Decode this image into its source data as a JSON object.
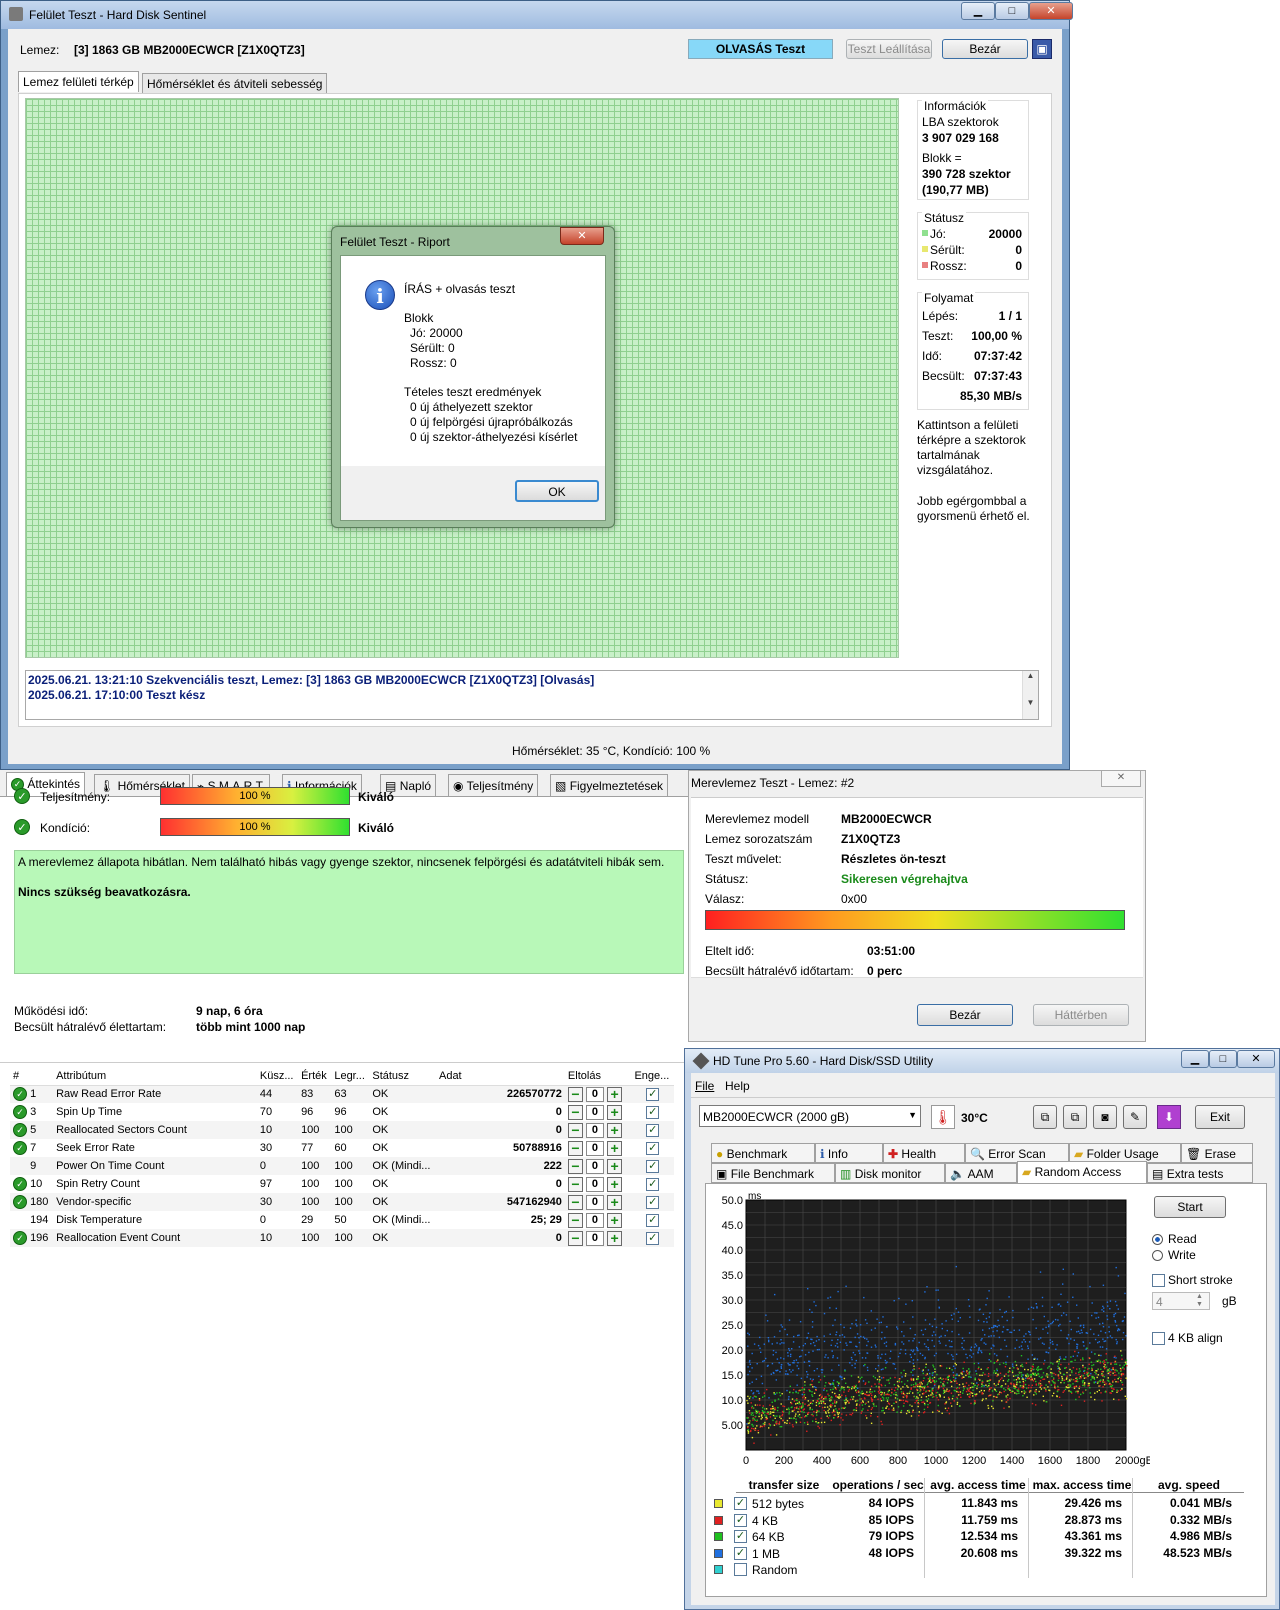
{
  "w1": {
    "title": "Felület Teszt - Hard Disk Sentinel",
    "disk_label": "Lemez:",
    "disk_value": "[3] 1863 GB  MB2000ECWCR [Z1X0QTZ3]",
    "mode_badge": "OLVASÁS Teszt",
    "stop_button": "Teszt Leállítása",
    "close_button": "Bezár",
    "tabs": [
      "Lemez felületi térkép",
      "Hőmérséklet és átviteli sebesség"
    ],
    "info": {
      "group": "Információk",
      "lba_label": "LBA szektorok",
      "lba_value": "3 907 029 168",
      "block_label": "Blokk =",
      "block_sectors": "390 728 szektor",
      "block_size": "(190,77 MB)"
    },
    "status": {
      "group": "Státusz",
      "good_label": "Jó:",
      "good_value": "20000",
      "damaged_label": "Sérült:",
      "damaged_value": "0",
      "bad_label": "Rossz:",
      "bad_value": "0"
    },
    "progress": {
      "group": "Folyamat",
      "step_label": "Lépés:",
      "step_value": "1 / 1",
      "test_label": "Teszt:",
      "test_value": "100,00 %",
      "time_label": "Idő:",
      "time_value": "07:37:42",
      "est_label": "Becsült:",
      "est_value": "07:37:43",
      "speed": "85,30 MB/s"
    },
    "hint1": "Kattintson a felületi térképre a szektorok tartalmának vizsgálatához.",
    "hint2": "Jobb egérgombbal a gyorsmenü érhető el.",
    "log": [
      "2025.06.21.  13:21:10   Szekvenciális teszt, Lemez: [3] 1863 GB  MB2000ECWCR [Z1X0QTZ3] [Olvasás]",
      "2025.06.21.  17:10:00   Teszt kész"
    ],
    "statusbar": "Hőmérséklet: 35  °C,  Kondíció: 100 %"
  },
  "dialog": {
    "title": "Felület Teszt - Riport",
    "heading": "ÍRÁS + olvasás teszt",
    "block": "Blokk",
    "good": "Jó: 20000",
    "damaged": "Sérült: 0",
    "bad": "Rossz: 0",
    "results_title": "Tételes teszt eredmények",
    "r1": "0 új áthelyezett szektor",
    "r2": "0 új felpörgési újrapróbálkozás",
    "r3": "0 új szektor-áthelyezési kísérlet",
    "ok": "OK"
  },
  "w2": {
    "tabs": [
      "Áttekintés",
      "Hőmérséklet",
      "S.M.A.R.T.",
      "Információk",
      "Napló",
      "Teljesítmény",
      "Figyelmeztetések"
    ],
    "perf_label": "Teljesítmény:",
    "perf_bar": "100 %",
    "perf_rating": "Kiváló",
    "perf_percent": 100,
    "cond_label": "Kondíció:",
    "cond_bar": "100 %",
    "cond_rating": "Kiváló",
    "cond_percent": 100,
    "message": "A merevlemez állapota hibátlan. Nem található hibás vagy gyenge szektor, nincsenek felpörgési és adatátviteli hibák sem.",
    "message_bold": "Nincs szükség beavatkozásra.",
    "uptime_label": "Működési idő:",
    "uptime_value": "9 nap, 6 óra",
    "life_label": "Becsült hátralévő élettartam:",
    "life_value": "több mint 1000 nap",
    "smart_headers": [
      "#",
      "Attribútum",
      "Küsz...",
      "Érték",
      "Legr...",
      "Státusz",
      "Adat",
      "Eltolás",
      "Enge..."
    ],
    "smart_rows": [
      {
        "ok": true,
        "id": "1",
        "name": "Raw Read Error Rate",
        "thr": "44",
        "val": "83",
        "worst": "63",
        "status": "OK",
        "data": "226570772",
        "offset": "0"
      },
      {
        "ok": true,
        "id": "3",
        "name": "Spin Up Time",
        "thr": "70",
        "val": "96",
        "worst": "96",
        "status": "OK",
        "data": "0",
        "offset": "0"
      },
      {
        "ok": true,
        "id": "5",
        "name": "Reallocated Sectors Count",
        "thr": "10",
        "val": "100",
        "worst": "100",
        "status": "OK",
        "data": "0",
        "offset": "0"
      },
      {
        "ok": true,
        "id": "7",
        "name": "Seek Error Rate",
        "thr": "30",
        "val": "77",
        "worst": "60",
        "status": "OK",
        "data": "50788916",
        "offset": "0"
      },
      {
        "ok": false,
        "id": "9",
        "name": "Power On Time Count",
        "thr": "0",
        "val": "100",
        "worst": "100",
        "status": "OK (Mindi...",
        "data": "222",
        "offset": "0"
      },
      {
        "ok": true,
        "id": "10",
        "name": "Spin Retry Count",
        "thr": "97",
        "val": "100",
        "worst": "100",
        "status": "OK",
        "data": "0",
        "offset": "0"
      },
      {
        "ok": true,
        "id": "180",
        "name": "Vendor-specific",
        "thr": "30",
        "val": "100",
        "worst": "100",
        "status": "OK",
        "data": "547162940",
        "offset": "0"
      },
      {
        "ok": false,
        "id": "194",
        "name": "Disk Temperature",
        "thr": "0",
        "val": "29",
        "worst": "50",
        "status": "OK (Mindi...",
        "data": "25; 29",
        "offset": "0"
      },
      {
        "ok": true,
        "id": "196",
        "name": "Reallocation Event Count",
        "thr": "10",
        "val": "100",
        "worst": "100",
        "status": "OK",
        "data": "0",
        "offset": "0"
      }
    ]
  },
  "w3": {
    "title": "Merevlemez Teszt - Lemez: #2",
    "model_label": "Merevlemez modell",
    "model_value": "MB2000ECWCR",
    "serial_label": "Lemez sorozatszám",
    "serial_value": "Z1X0QTZ3",
    "op_label": "Teszt művelet:",
    "op_value": "Részletes ön-teszt",
    "status_label": "Státusz:",
    "status_value": "Sikeresen végrehajtva",
    "resp_label": "Válasz:",
    "resp_value": "0x00",
    "elapsed_label": "Eltelt idő:",
    "elapsed_value": "03:51:00",
    "remain_label": "Becsült hátralévő időtartam:",
    "remain_value": "0 perc",
    "close_button": "Bezár",
    "bg_button": "Háttérben",
    "status_color": "#1a8a1a"
  },
  "w4": {
    "title": "HD Tune Pro 5.60 - Hard Disk/SSD Utility",
    "menu": [
      "File",
      "Help"
    ],
    "drive": "MB2000ECWCR (2000 gB)",
    "temp": "30°C",
    "exit": "Exit",
    "tabs_row1": [
      "Benchmark",
      "Info",
      "Health",
      "Error Scan",
      "Folder Usage",
      "Erase"
    ],
    "tabs_row2": [
      "File Benchmark",
      "Disk monitor",
      "AAM",
      "Random Access",
      "Extra tests"
    ],
    "start": "Start",
    "read": "Read",
    "write": "Write",
    "short_stroke": "Short stroke",
    "stroke_value": "4",
    "stroke_unit": "gB",
    "align": "4 KB align",
    "results_headers": [
      "transfer size",
      "operations / sec",
      "avg. access time",
      "max. access time",
      "avg. speed"
    ],
    "results": [
      {
        "size": "512 bytes",
        "ops": "84 IOPS",
        "avg": "11.843 ms",
        "max": "29.426 ms",
        "speed": "0.041 MB/s",
        "color": "#e8e830",
        "checked": true
      },
      {
        "size": "4 KB",
        "ops": "85 IOPS",
        "avg": "11.759 ms",
        "max": "28.873 ms",
        "speed": "0.332 MB/s",
        "color": "#e02020",
        "checked": true
      },
      {
        "size": "64 KB",
        "ops": "79 IOPS",
        "avg": "12.534 ms",
        "max": "43.361 ms",
        "speed": "4.986 MB/s",
        "color": "#20c020",
        "checked": true
      },
      {
        "size": "1 MB",
        "ops": "48 IOPS",
        "avg": "20.608 ms",
        "max": "39.322 ms",
        "speed": "48.523 MB/s",
        "color": "#2070e0",
        "checked": true
      },
      {
        "size": "Random",
        "ops": "",
        "avg": "",
        "max": "",
        "speed": "",
        "color": "#30d0d0",
        "checked": false
      }
    ]
  },
  "chart_data": {
    "type": "scatter",
    "xlabel": "",
    "ylabel": "ms",
    "x_unit": "gB",
    "xlim": [
      0,
      2000
    ],
    "ylim": [
      0,
      50
    ],
    "x_ticks": [
      "0",
      "200",
      "400",
      "600",
      "800",
      "1000",
      "1200",
      "1400",
      "1600",
      "1800",
      "2000gB"
    ],
    "y_ticks": [
      "50.0",
      "45.0",
      "40.0",
      "35.0",
      "30.0",
      "25.0",
      "20.0",
      "15.0",
      "10.0",
      "5.00"
    ],
    "grid": true,
    "series": [
      {
        "name": "512 bytes",
        "color": "#e8e830",
        "trend": [
          [
            0,
            6
          ],
          [
            400,
            9.5
          ],
          [
            800,
            11.5
          ],
          [
            1200,
            13
          ],
          [
            1600,
            14
          ],
          [
            2000,
            15
          ]
        ],
        "spread": 3.5
      },
      {
        "name": "4 KB",
        "color": "#e02020",
        "trend": [
          [
            0,
            6
          ],
          [
            400,
            9.5
          ],
          [
            800,
            11.5
          ],
          [
            1200,
            12.8
          ],
          [
            1600,
            13.8
          ],
          [
            2000,
            14.8
          ]
        ],
        "spread": 3.5
      },
      {
        "name": "64 KB",
        "color": "#20c020",
        "trend": [
          [
            0,
            7
          ],
          [
            400,
            10.5
          ],
          [
            800,
            12.5
          ],
          [
            1200,
            14
          ],
          [
            1600,
            15
          ],
          [
            2000,
            16
          ]
        ],
        "spread": 3.5
      },
      {
        "name": "1 MB",
        "color": "#2070e0",
        "trend": [
          [
            0,
            15
          ],
          [
            400,
            18
          ],
          [
            800,
            20
          ],
          [
            1200,
            21.5
          ],
          [
            1600,
            22.5
          ],
          [
            2000,
            23
          ]
        ],
        "spread": 6
      }
    ]
  }
}
